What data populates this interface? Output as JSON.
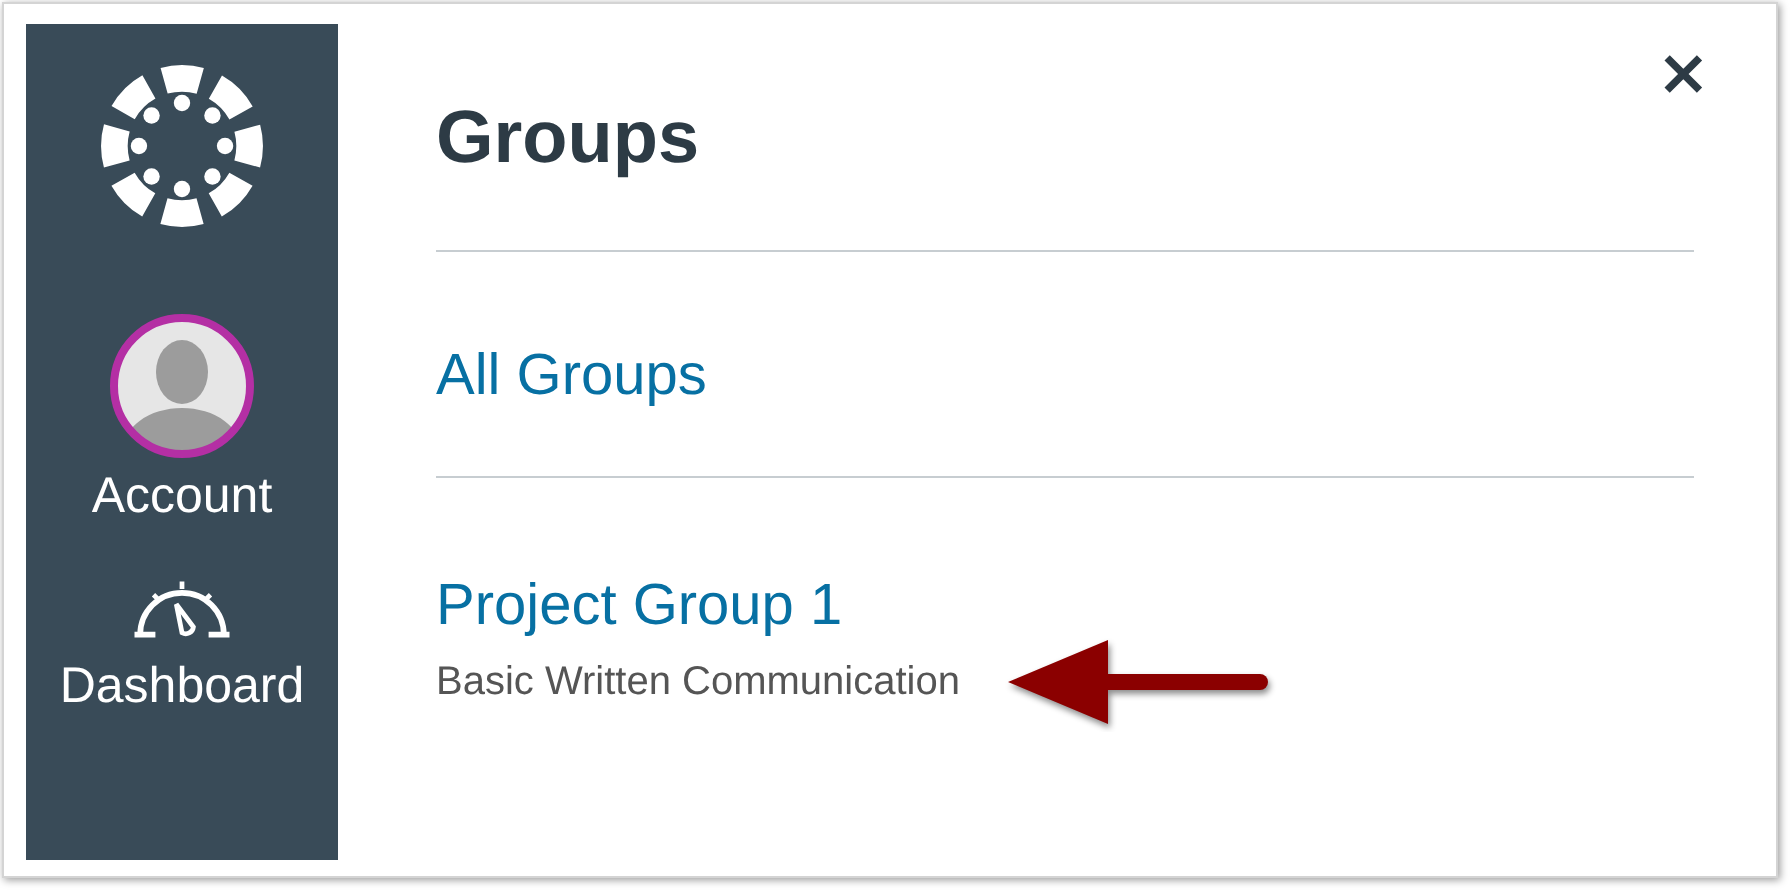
{
  "sidebar": {
    "items": [
      {
        "kind": "logo"
      },
      {
        "kind": "avatar",
        "label": "Account"
      },
      {
        "kind": "dashboard",
        "label": "Dashboard"
      }
    ]
  },
  "tray": {
    "title": "Groups",
    "close": "×",
    "groups": [
      {
        "name": "All Groups"
      },
      {
        "name": "Project Group 1",
        "term": "Basic Written Communication"
      }
    ]
  }
}
